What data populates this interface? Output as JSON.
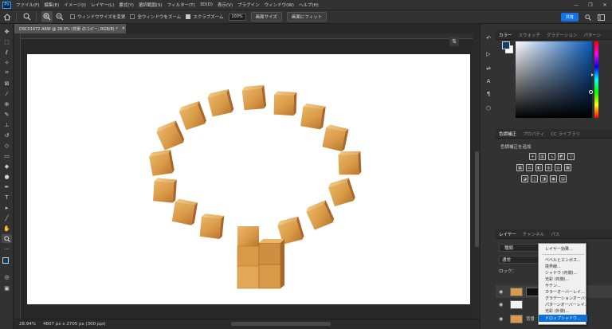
{
  "app": {
    "logo": "Ps"
  },
  "menu": [
    "ファイル(F)",
    "編集(E)",
    "イメージ(I)",
    "レイヤー(L)",
    "書式(Y)",
    "選択範囲(S)",
    "フィルター(T)",
    "3D(D)",
    "表示(V)",
    "プラグイン",
    "ウィンドウ(W)",
    "ヘルプ(H)"
  ],
  "options": {
    "resize_windows_label": "ウィンドウサイズを変更",
    "zoom_all_label": "全ウィンドウをズーム",
    "scrubby_zoom_label": "スクラブズーム",
    "scrubby_zoom_checked": true,
    "zoom_value": "100%",
    "fit_screen_label": "画面サイズ",
    "fill_screen_label": "画面にフィット",
    "share_label": "共有"
  },
  "document": {
    "tab_title": "DSC01472.ARW @ 28.9% (背景 のコピー, RGB/8) *",
    "zoom": "28.94%",
    "info": "4807 px x 2705 px (300 ppi)"
  },
  "panels": {
    "color_tabs": [
      "カラー",
      "スウォッチ",
      "グラデーション",
      "パターン"
    ],
    "adjust_tabs": [
      "色調補正",
      "プロパティ",
      "CC ライブラリ"
    ],
    "adjust_label": "色調補正を追加",
    "layers_tabs": [
      "レイヤー",
      "チャンネル",
      "パス"
    ],
    "search_placeholder": "種類",
    "blend_mode": "通常",
    "lock_label": "ロック：",
    "layer_background": "背景"
  },
  "context_menu": [
    "レイヤー効果...",
    "ベベルとエンボス...",
    "境界線...",
    "シャドウ (内側)...",
    "光彩 (内側)...",
    "サテン...",
    "カラーオーバーレイ...",
    "グラデーションオーバーレイ...",
    "パターンオーバーレイ...",
    "光彩 (外側)...",
    "ドロップシャドウ..."
  ],
  "colors": {
    "accent": "#1473e6",
    "highlight": "#0b6fd4",
    "foreground": "#0d3f6a",
    "block_light": "#e2a858",
    "block_dark": "#b9742c"
  }
}
